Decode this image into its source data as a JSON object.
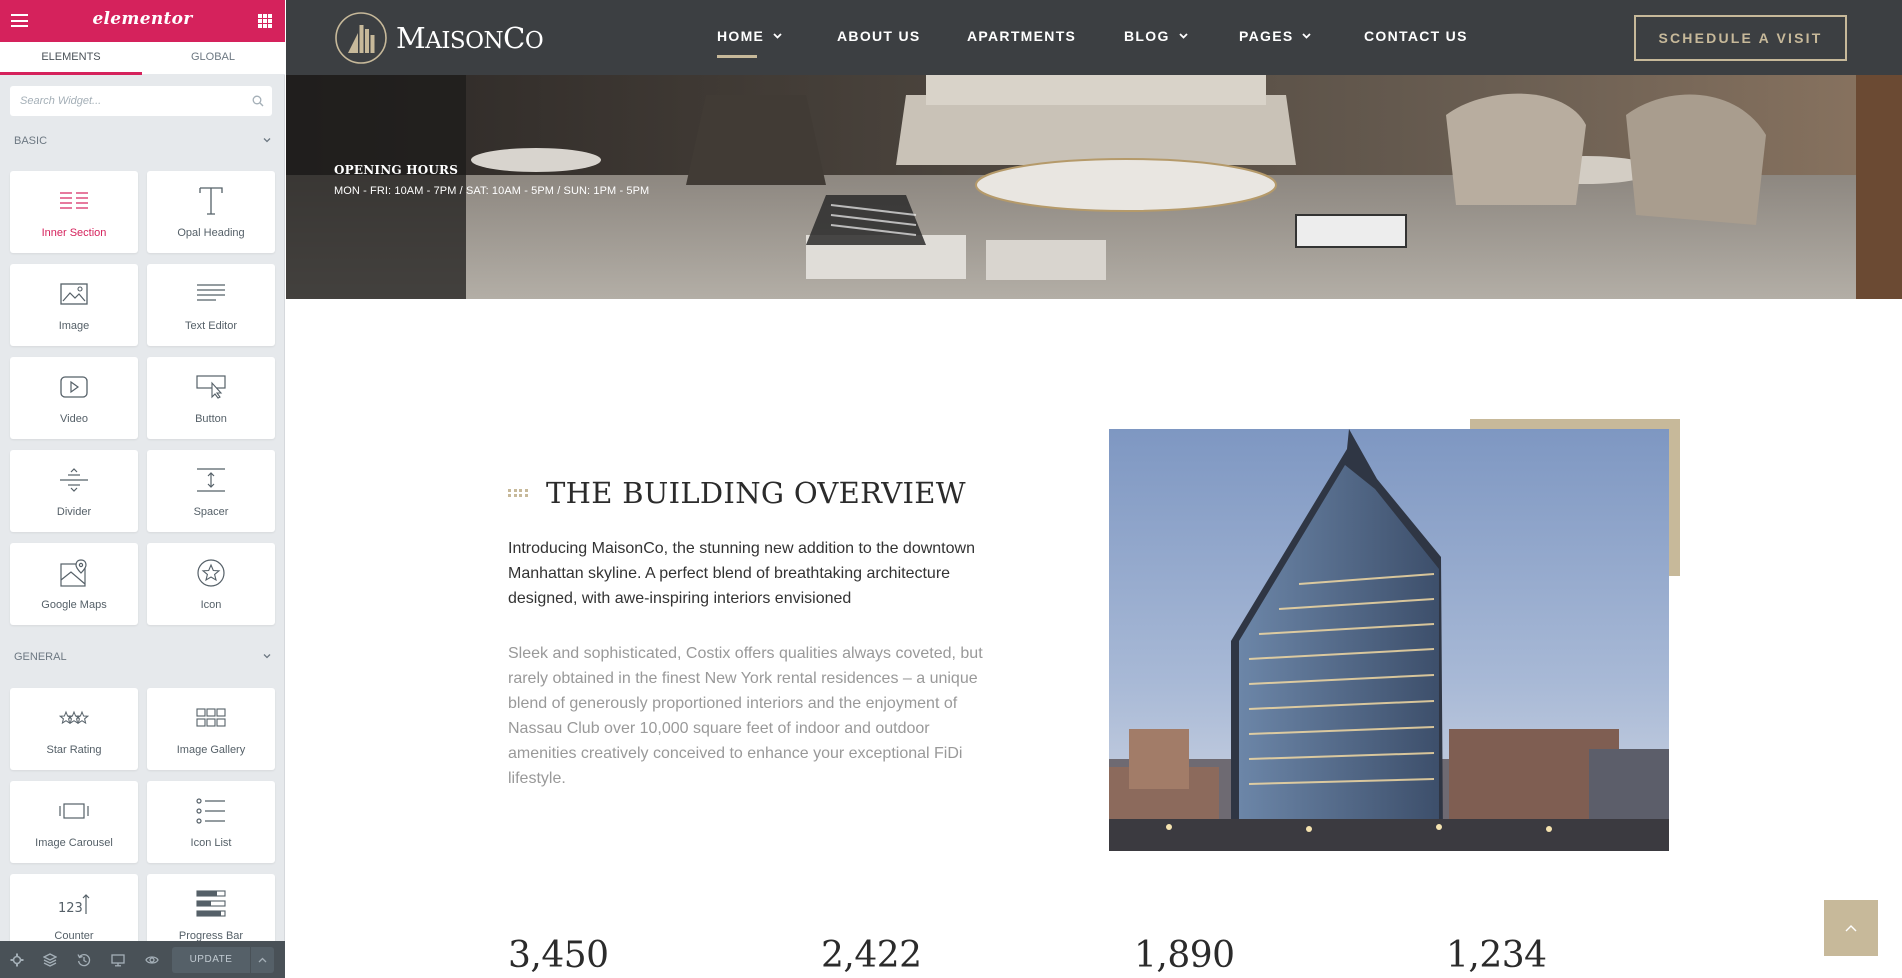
{
  "editor": {
    "brand": "elementor",
    "tabs": [
      {
        "label": "ELEMENTS"
      },
      {
        "label": "GLOBAL"
      }
    ],
    "search": {
      "placeholder": "Search Widget..."
    },
    "categories": [
      {
        "label": "BASIC",
        "widgets": [
          {
            "label": "Inner Section",
            "icon": "inner-section-icon"
          },
          {
            "label": "Opal Heading",
            "icon": "heading-icon"
          },
          {
            "label": "Image",
            "icon": "image-icon"
          },
          {
            "label": "Text Editor",
            "icon": "text-editor-icon"
          },
          {
            "label": "Video",
            "icon": "video-icon"
          },
          {
            "label": "Button",
            "icon": "button-icon"
          },
          {
            "label": "Divider",
            "icon": "divider-icon"
          },
          {
            "label": "Spacer",
            "icon": "spacer-icon"
          },
          {
            "label": "Google Maps",
            "icon": "map-icon"
          },
          {
            "label": "Icon",
            "icon": "star-icon"
          }
        ]
      },
      {
        "label": "GENERAL",
        "widgets": [
          {
            "label": "Star Rating",
            "icon": "star-rating-icon"
          },
          {
            "label": "Image Gallery",
            "icon": "gallery-icon"
          },
          {
            "label": "Image Carousel",
            "icon": "carousel-icon"
          },
          {
            "label": "Icon List",
            "icon": "list-icon"
          },
          {
            "label": "Counter",
            "icon": "counter-icon"
          },
          {
            "label": "Progress Bar",
            "icon": "progress-bar-icon"
          }
        ]
      }
    ],
    "footer": {
      "update_label": "UPDATE"
    },
    "colors": {
      "accent": "#d5225c",
      "panel": "#e6e9ec",
      "footer": "#495157"
    }
  },
  "site": {
    "logo_text_cap": "M",
    "logo_text_rest": "AISON",
    "logo_text_cap2": "C",
    "logo_text_rest2": "O",
    "nav": [
      {
        "label": "HOME",
        "has_dropdown": true,
        "active": true
      },
      {
        "label": "ABOUT US",
        "has_dropdown": false
      },
      {
        "label": "APARTMENTS",
        "has_dropdown": false
      },
      {
        "label": "BLOG",
        "has_dropdown": true
      },
      {
        "label": "PAGES",
        "has_dropdown": true
      },
      {
        "label": "CONTACT US",
        "has_dropdown": false
      }
    ],
    "cta_label": "SCHEDULE A VISIT",
    "hero": {
      "hours_title": "OPENING HOURS",
      "hours_text": "MON - FRI: 10AM - 7PM / SAT: 10AM - 5PM / SUN: 1PM - 5PM"
    },
    "overview": {
      "title": "THE BUILDING OVERVIEW",
      "intro": "Introducing MaisonCo, the stunning new addition to the downtown Manhattan skyline. A perfect blend of breathtaking architecture designed, with awe-inspiring interiors envisioned",
      "body": "Sleek and sophisticated, Costix offers qualities always coveted, but rarely obtained in the finest New York rental residences – a unique blend of generously proportioned interiors and the enjoyment of Nassau Club over 10,000 square feet of indoor and outdoor amenities creatively conceived to enhance your exceptional FiDi lifestyle."
    },
    "stats": [
      "3,450",
      "2,422",
      "1,890",
      "1,234"
    ],
    "colors": {
      "nav_bg": "#3c3f42",
      "gold": "#c7b99a"
    }
  }
}
